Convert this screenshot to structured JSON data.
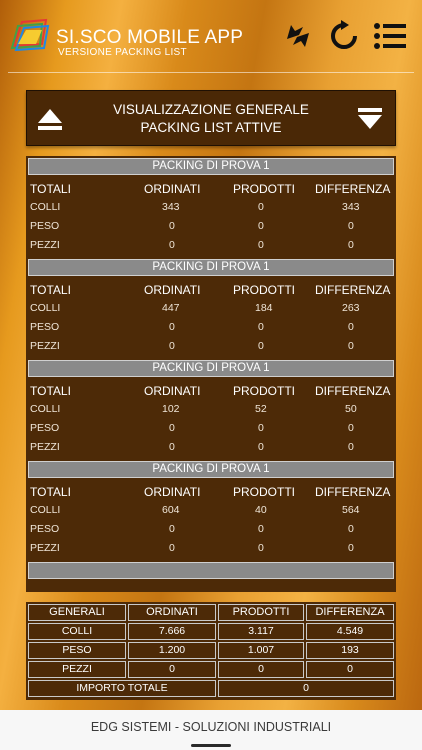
{
  "app": {
    "title": "SI.SCO MOBILE APP",
    "subtitle": "VERSIONE PACKING LIST",
    "icons": [
      "sync-icon",
      "refresh-icon",
      "menu-icon"
    ]
  },
  "view": {
    "title_line1": "VISUALIZZAZIONE GENERALE",
    "title_line2": "PACKING LIST ATTIVE"
  },
  "columns": {
    "totali": "TOTALI",
    "ordinati": "ORDINATI",
    "prodotti": "PRODOTTI",
    "differenza": "DIFFERENZA"
  },
  "row_labels": {
    "colli": "COLLI",
    "peso": "PESO",
    "pezzi": "PEZZI"
  },
  "packings": [
    {
      "name": "PACKING DI PROVA 1",
      "colli": [
        "343",
        "0",
        "343"
      ],
      "peso": [
        "0",
        "0",
        "0"
      ],
      "pezzi": [
        "0",
        "0",
        "0"
      ]
    },
    {
      "name": "PACKING DI PROVA 1",
      "colli": [
        "447",
        "184",
        "263"
      ],
      "peso": [
        "0",
        "0",
        "0"
      ],
      "pezzi": [
        "0",
        "0",
        "0"
      ]
    },
    {
      "name": "PACKING DI PROVA 1",
      "colli": [
        "102",
        "52",
        "50"
      ],
      "peso": [
        "0",
        "0",
        "0"
      ],
      "pezzi": [
        "0",
        "0",
        "0"
      ]
    },
    {
      "name": "PACKING DI PROVA 1",
      "colli": [
        "604",
        "40",
        "564"
      ],
      "peso": [
        "0",
        "0",
        "0"
      ],
      "pezzi": [
        "0",
        "0",
        "0"
      ]
    },
    {
      "name": "",
      "colli": [
        "",
        "",
        ""
      ],
      "peso": [
        "",
        "",
        ""
      ],
      "pezzi": [
        "",
        "",
        ""
      ]
    }
  ],
  "totals": {
    "header": [
      "GENERALI",
      "ORDINATI",
      "PRODOTTI",
      "DIFFERENZA"
    ],
    "rows": [
      [
        "COLLI",
        "7.666",
        "3.117",
        "4.549"
      ],
      [
        "PESO",
        "1.200",
        "1.007",
        "193"
      ],
      [
        "PEZZI",
        "0",
        "0",
        "0"
      ]
    ],
    "importo_label": "IMPORTO TOTALE",
    "importo_value": "0"
  },
  "footer": {
    "text": "EDG SISTEMI - SOLUZIONI INDUSTRIALI"
  },
  "colors": {
    "panel": "#4d2a07",
    "header_cell": "#8a8a8a",
    "accent_orange": "#e69a1e"
  }
}
